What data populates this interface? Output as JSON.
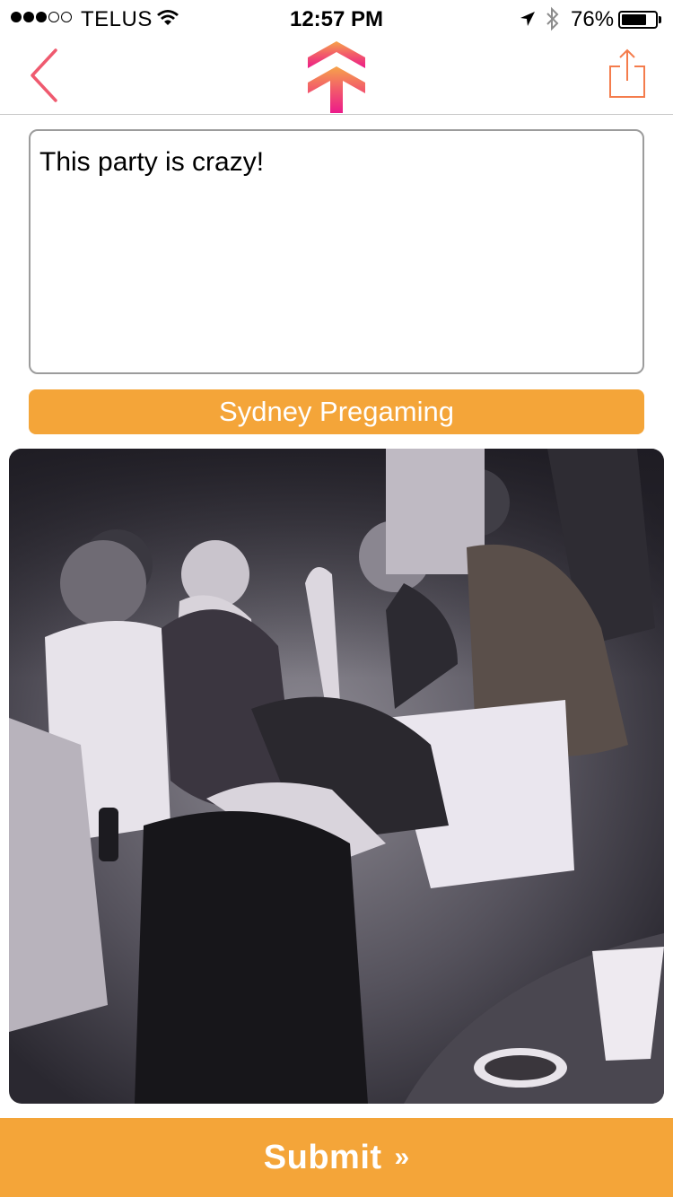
{
  "status_bar": {
    "carrier": "TELUS",
    "signal_bars": 3,
    "signal_total": 5,
    "time": "12:57 PM",
    "battery_percent": "76%",
    "battery_level": 0.76
  },
  "nav": {
    "back_icon": "chevron-left-icon",
    "logo_icon": "double-arrow-up-logo",
    "share_icon": "share-icon",
    "accent_color": "#ef5a6f",
    "share_color": "#f47c4c"
  },
  "post": {
    "text": "This party is crazy!"
  },
  "location": {
    "label": "Sydney Pregaming",
    "color": "#f4a539"
  },
  "photo": {
    "description_icon": "party-photo"
  },
  "submit": {
    "label": "Submit",
    "icon": "»",
    "color": "#f4a539"
  }
}
